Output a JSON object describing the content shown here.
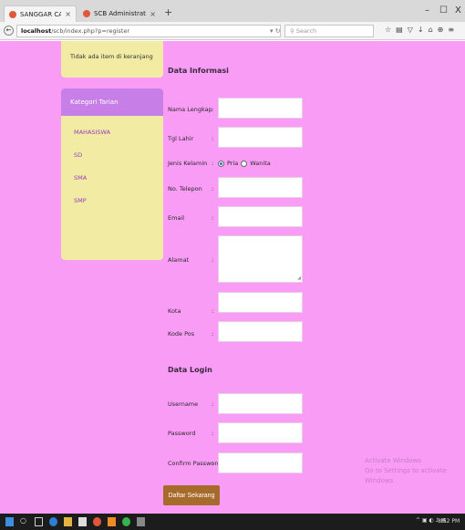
{
  "browser": {
    "tabs": [
      {
        "title": "SANGGAR CANGGET BUD..."
      },
      {
        "title": "SCB Administrator"
      }
    ],
    "new_tab_glyph": "+",
    "window_controls": {
      "minimize": "–",
      "maximize": "☐",
      "close": "X"
    },
    "url_host": "localhost",
    "url_path": "/scb/index.php?p=register",
    "search_placeholder": "Search"
  },
  "sidebar": {
    "cart_empty_text": "Tidak ada item di keranjang",
    "category_title": "Kategori Tarian",
    "categories": [
      "MAHASISWA",
      "SD",
      "SMA",
      "SMP"
    ]
  },
  "form": {
    "info_title": "Data Informasi",
    "fields": {
      "nama": "Nama Lengkap",
      "tgl": "Tgl Lahir",
      "jk": "Jenis Kelamin",
      "telp": "No. Telepon",
      "email": "Email",
      "alamat": "Alamat",
      "kota": "Kota",
      "kodepos": "Kode Pos"
    },
    "colon": ":",
    "gender_options": [
      "Pria",
      "Wanita"
    ],
    "gender_selected": "Pria",
    "login_title": "Data Login",
    "login_fields": {
      "username": "Username",
      "password": "Password",
      "confirm": "Confirm Password"
    },
    "submit_label": "Daftar Sekarang"
  },
  "watermark": {
    "line1": "Activate Windows",
    "line2": "Go to Settings to activate Windows."
  },
  "taskbar": {
    "clock": "8:52 PM"
  }
}
